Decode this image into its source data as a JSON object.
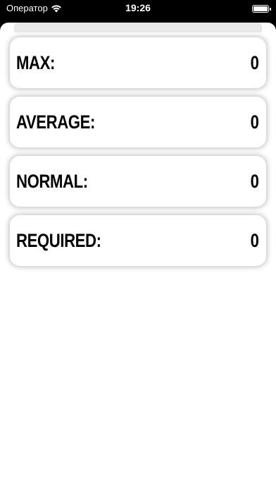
{
  "status_bar": {
    "carrier": "Оператор",
    "wifi_icon": "wifi-icon",
    "time": "19:26",
    "battery_icon": "battery-icon"
  },
  "cards": [
    {
      "label": "MAX:",
      "value": "0"
    },
    {
      "label": "AVERAGE:",
      "value": "0"
    },
    {
      "label": "NORMAL:",
      "value": "0"
    },
    {
      "label": "REQUIRED:",
      "value": "0"
    }
  ],
  "colors": {
    "background": "#000000",
    "sheet": "#ffffff",
    "text": "#000000"
  }
}
